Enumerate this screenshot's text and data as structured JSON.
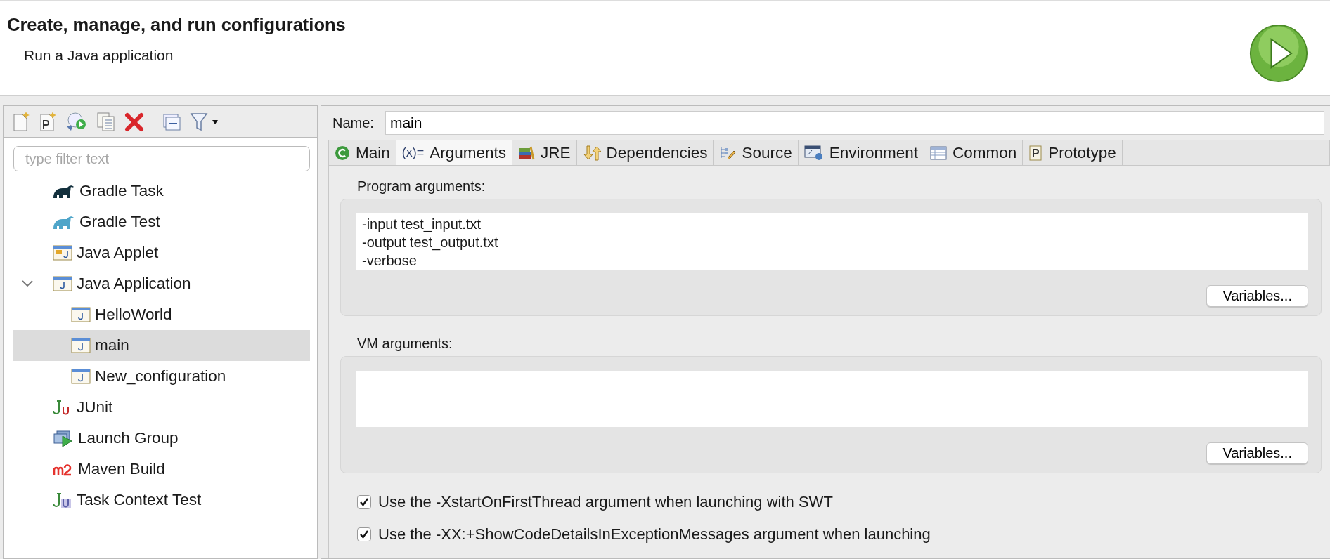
{
  "header": {
    "title": "Create, manage, and run configurations",
    "subtitle": "Run a Java application"
  },
  "filter": {
    "placeholder": "type filter text"
  },
  "tree": [
    {
      "label": "Gradle Task",
      "kind": "gradle-dark",
      "selected": false
    },
    {
      "label": "Gradle Test",
      "kind": "gradle-light",
      "selected": false
    },
    {
      "label": "Java Applet",
      "kind": "applet",
      "selected": false
    },
    {
      "label": "Java Application",
      "kind": "java",
      "expanded": true,
      "selected": false,
      "children": [
        {
          "label": "HelloWorld",
          "kind": "java",
          "selected": false
        },
        {
          "label": "main",
          "kind": "java",
          "selected": true
        },
        {
          "label": "New_configuration",
          "kind": "java",
          "selected": false
        }
      ]
    },
    {
      "label": "JUnit",
      "kind": "junit",
      "selected": false
    },
    {
      "label": "Launch Group",
      "kind": "group",
      "selected": false
    },
    {
      "label": "Maven Build",
      "kind": "m2",
      "selected": false
    },
    {
      "label": "Task Context Test",
      "kind": "taskjunit",
      "selected": false
    }
  ],
  "name": {
    "label": "Name:",
    "value": "main"
  },
  "tabs": [
    {
      "label": "Main",
      "kind": "main",
      "selected": false
    },
    {
      "label": "Arguments",
      "kind": "args",
      "selected": true
    },
    {
      "label": "JRE",
      "kind": "jre",
      "selected": false
    },
    {
      "label": "Dependencies",
      "kind": "deps",
      "selected": false
    },
    {
      "label": "Source",
      "kind": "source",
      "selected": false
    },
    {
      "label": "Environment",
      "kind": "env",
      "selected": false
    },
    {
      "label": "Common",
      "kind": "common",
      "selected": false
    },
    {
      "label": "Prototype",
      "kind": "proto",
      "selected": false
    }
  ],
  "args_icon_text": "(x)=",
  "groups": [
    {
      "label": "Program arguments:",
      "lines": [
        "-input  test_input.txt",
        "-output test_output.txt",
        "-verbose"
      ],
      "button": "Variables..."
    },
    {
      "label": "VM arguments:",
      "button": "Variables..."
    }
  ],
  "options": [
    {
      "label": "Use the -XstartOnFirstThread argument when launching with SWT",
      "checked": true
    },
    {
      "label": "Use the -XX:+ShowCodeDetailsInExceptionMessages argument when launching",
      "checked": true
    }
  ]
}
